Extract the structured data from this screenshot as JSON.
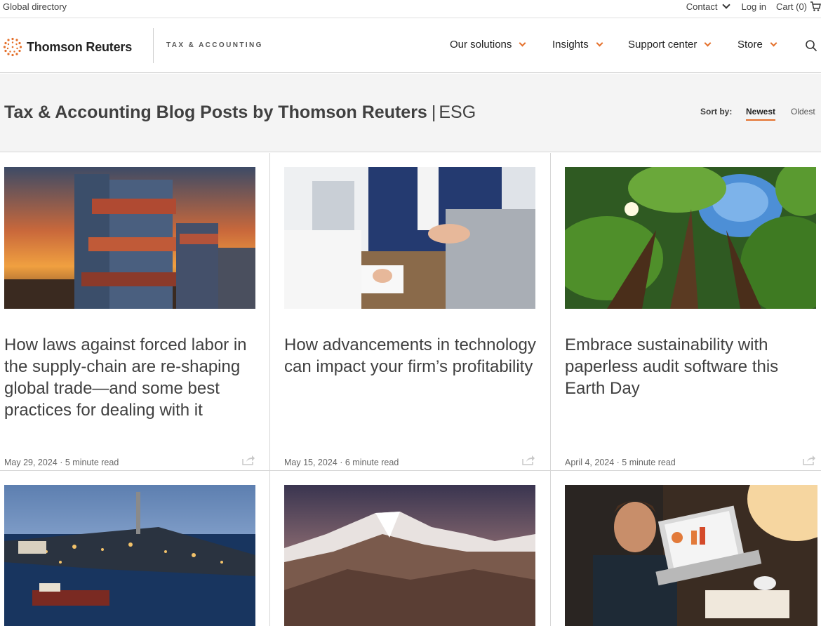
{
  "utility": {
    "global_directory": "Global directory",
    "contact": "Contact",
    "login": "Log in",
    "cart": "Cart (0)"
  },
  "header": {
    "brand": "Thomson Reuters",
    "division": "TAX & ACCOUNTING",
    "nav": [
      {
        "label": "Our solutions"
      },
      {
        "label": "Insights"
      },
      {
        "label": "Support center"
      },
      {
        "label": "Store"
      }
    ]
  },
  "banner": {
    "title": "Tax & Accounting Blog Posts by Thomson Reuters",
    "separator": "|",
    "tag": "ESG",
    "sort_label": "Sort by:",
    "sort_options": [
      "Newest",
      "Oldest"
    ],
    "sort_selected": "Newest"
  },
  "cards": [
    {
      "image": "shipping-containers-sunset",
      "title": "How laws against forced labor in the supply-chain are re-shaping global trade—and some best practices for dealing with it",
      "meta": "May 29, 2024 · 5 minute read"
    },
    {
      "image": "business-handshake",
      "title": "How advancements in technology can impact your firm’s profitability",
      "meta": "May 15, 2024 · 6 minute read"
    },
    {
      "image": "forest-canopy-sky",
      "title": "Embrace sustainability with paperless audit software this Earth Day",
      "meta": "April 4, 2024 · 5 minute read"
    },
    {
      "image": "industrial-port-night",
      "title": "",
      "meta": ""
    },
    {
      "image": "mountain-range-dusk",
      "title": "",
      "meta": ""
    },
    {
      "image": "person-laptop-charts",
      "title": "",
      "meta": ""
    }
  ],
  "colors": {
    "accent": "#e4702b",
    "text": "#404040",
    "banner_bg": "#f4f4f4"
  }
}
